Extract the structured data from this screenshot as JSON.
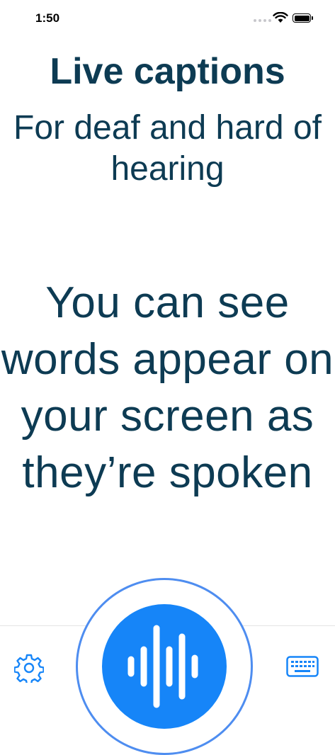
{
  "status_bar": {
    "time": "1:50"
  },
  "header": {
    "title": "Live captions",
    "subtitle": "For deaf and hard of hearing"
  },
  "caption": {
    "text": "You can see words appear on your screen as they’re spoken"
  },
  "toolbar": {
    "left_icon": "gear-icon",
    "right_icon": "keyboard-icon",
    "center_icon": "waveform-icon"
  },
  "colors": {
    "text": "#0d3b53",
    "accent": "#1685f8",
    "ring": "#4e8df0"
  }
}
